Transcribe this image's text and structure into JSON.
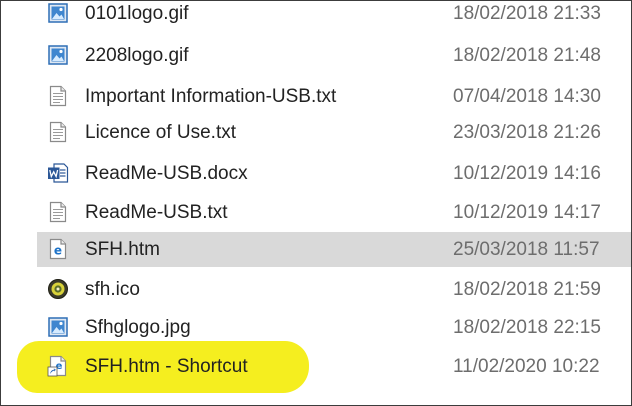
{
  "files": [
    {
      "name": "0101logo.gif",
      "date": "18/02/2018 21:33",
      "icon": "image-file-icon"
    },
    {
      "name": "2208logo.gif",
      "date": "18/02/2018 21:48",
      "icon": "image-file-icon"
    },
    {
      "name": "Important Information-USB.txt",
      "date": "07/04/2018 14:30",
      "icon": "text-file-icon"
    },
    {
      "name": "Licence of Use.txt",
      "date": "23/03/2018 21:26",
      "icon": "text-file-icon"
    },
    {
      "name": "ReadMe-USB.docx",
      "date": "10/12/2019 14:16",
      "icon": "word-document-icon"
    },
    {
      "name": "ReadMe-USB.txt",
      "date": "10/12/2019 14:17",
      "icon": "text-file-icon"
    },
    {
      "name": "SFH.htm",
      "date": "25/03/2018 11:57",
      "icon": "html-file-icon",
      "selected": true
    },
    {
      "name": "sfh.ico",
      "date": "18/02/2018 21:59",
      "icon": "ico-file-icon"
    },
    {
      "name": "Sfhglogo.jpg",
      "date": "18/02/2018 22:15",
      "icon": "image-file-icon"
    },
    {
      "name": "SFH.htm - Shortcut",
      "date": "11/02/2020 10:22",
      "icon": "shortcut-file-icon",
      "highlighted": true
    }
  ],
  "colors": {
    "selection": "#d9d9d9",
    "highlighter": "#f5ee1f",
    "name_text": "#222222",
    "date_text": "#6d6d6d"
  }
}
